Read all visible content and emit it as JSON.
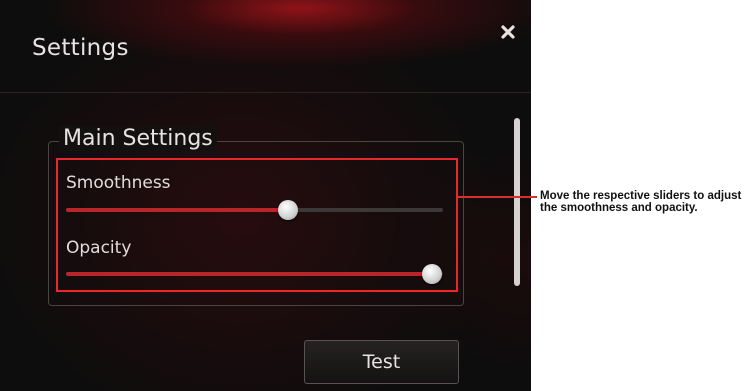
{
  "window": {
    "title": "Settings",
    "close_icon": "close-icon"
  },
  "group": {
    "title": "Main Settings"
  },
  "sliders": [
    {
      "label": "Smoothness",
      "value": 0.59
    },
    {
      "label": "Opacity",
      "value": 0.97
    }
  ],
  "actions": {
    "test_label": "Test"
  },
  "annotation": {
    "text": "Move the respective sliders to adjust the smoothness and opacity."
  },
  "colors": {
    "accent": "#e32b2b",
    "slider_fill": "#b8252b"
  }
}
